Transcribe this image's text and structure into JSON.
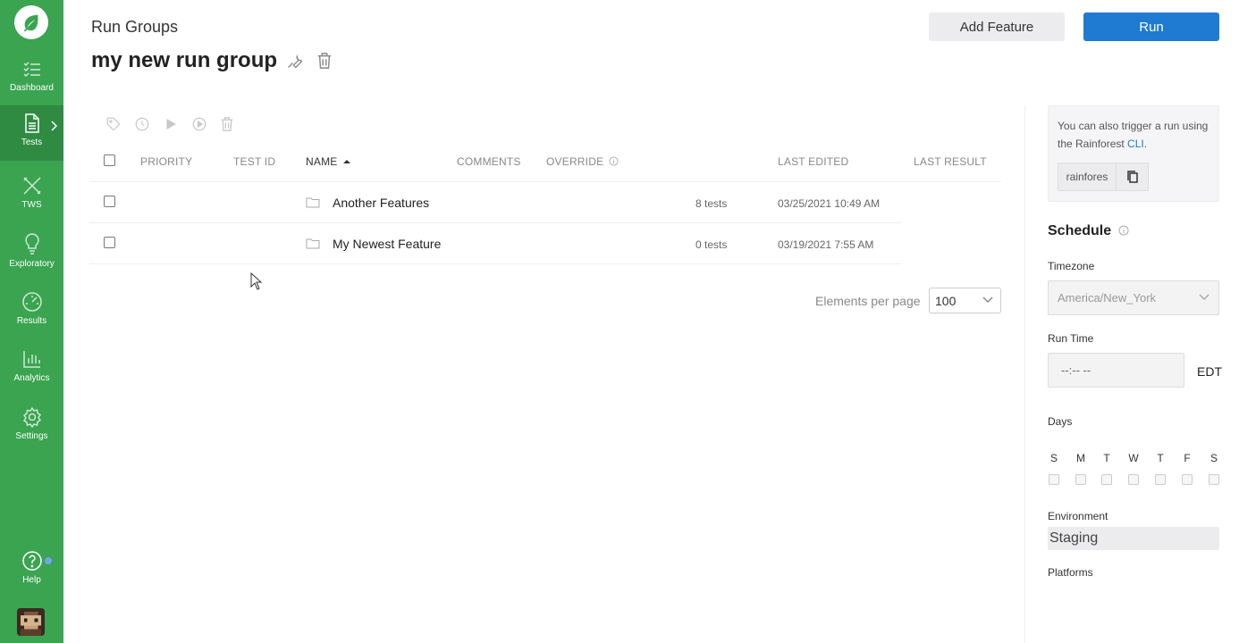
{
  "sidebar": {
    "items": [
      {
        "label": "Dashboard",
        "icon": "checklist-icon"
      },
      {
        "label": "Tests",
        "icon": "document-icon"
      },
      {
        "label": "TWS",
        "icon": "tools-icon"
      },
      {
        "label": "Exploratory",
        "icon": "lightbulb-icon"
      },
      {
        "label": "Results",
        "icon": "gauge-icon"
      },
      {
        "label": "Analytics",
        "icon": "bar-chart-icon"
      },
      {
        "label": "Settings",
        "icon": "gear-icon"
      }
    ],
    "help_label": "Help",
    "active": "Tests"
  },
  "header": {
    "breadcrumb": "Run Groups",
    "title": "my new run group",
    "add_feature_label": "Add Feature",
    "run_label": "Run"
  },
  "table": {
    "columns": {
      "priority": "PRIORITY",
      "test_id": "TEST ID",
      "name": "NAME",
      "comments": "COMMENTS",
      "override": "OVERRIDE",
      "last_edited": "LAST EDITED",
      "last_result": "LAST RESULT"
    },
    "rows": [
      {
        "name": "Another Features",
        "count": "8 tests",
        "last_edited": "03/25/2021 10:49 AM"
      },
      {
        "name": "My Newest Feature",
        "count": "0 tests",
        "last_edited": "03/19/2021 7:55 AM"
      }
    ],
    "elements_per_page_label": "Elements per page",
    "elements_per_page_value": "100"
  },
  "panel": {
    "cli_text_prefix": "You can also trigger a run using the Rainforest ",
    "cli_link": "CLI",
    "cli_text_suffix": ".",
    "cli_command": "rainfores",
    "schedule_heading": "Schedule",
    "timezone_label": "Timezone",
    "timezone_value": "America/New_York",
    "run_time_label": "Run Time",
    "run_time_value": "--:-- --",
    "timezone_abbr": "EDT",
    "days_label": "Days",
    "days": [
      "S",
      "M",
      "T",
      "W",
      "T",
      "F",
      "S"
    ],
    "environment_label": "Environment",
    "environment_value": "Staging",
    "platforms_label": "Platforms"
  },
  "colors": {
    "sidebar": "#3aa450",
    "sidebar_active": "#2f8b42",
    "primary": "#1f7ad1"
  }
}
